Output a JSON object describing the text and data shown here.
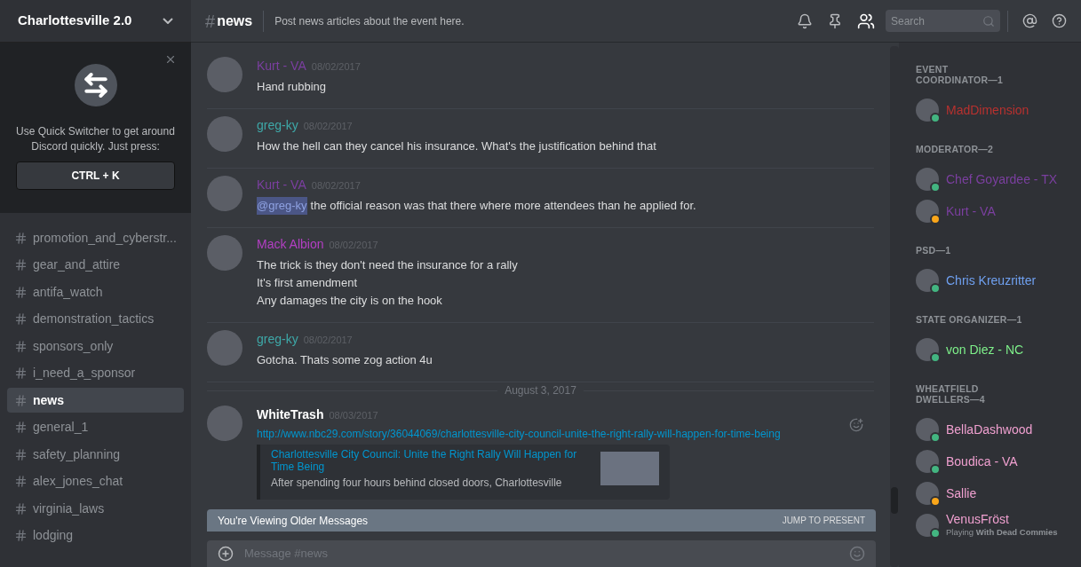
{
  "server": {
    "name": "Charlottesville 2.0"
  },
  "quick_switcher": {
    "text": "Use Quick Switcher to get around Discord quickly. Just press:",
    "shortcut": "CTRL + K"
  },
  "channels": [
    {
      "name": "promotion_and_cyberstr...",
      "selected": false
    },
    {
      "name": "gear_and_attire",
      "selected": false
    },
    {
      "name": "antifa_watch",
      "selected": false
    },
    {
      "name": "demonstration_tactics",
      "selected": false
    },
    {
      "name": "sponsors_only",
      "selected": false
    },
    {
      "name": "i_need_a_sponsor",
      "selected": false
    },
    {
      "name": "news",
      "selected": true
    },
    {
      "name": "general_1",
      "selected": false
    },
    {
      "name": "safety_planning",
      "selected": false
    },
    {
      "name": "alex_jones_chat",
      "selected": false
    },
    {
      "name": "virginia_laws",
      "selected": false
    },
    {
      "name": "lodging",
      "selected": false
    }
  ],
  "header": {
    "hash": "#",
    "channel": "news",
    "topic": "Post news articles about the event here.",
    "search_placeholder": "Search"
  },
  "messages": [
    {
      "author": "Kurt - VA",
      "color": "#7b3fa0",
      "time": "08/02/2017",
      "lines": [
        {
          "text": "Hand rubbing"
        }
      ]
    },
    {
      "author": "greg-ky",
      "color": "#3ea8a8",
      "time": "08/02/2017",
      "lines": [
        {
          "text": "How the hell can they cancel his insurance. What's the justification behind that"
        }
      ]
    },
    {
      "author": "Kurt - VA",
      "color": "#7b3fa0",
      "time": "08/02/2017",
      "lines": [
        {
          "mention": "@greg-ky",
          "text": "the official reason was that there where more attendees than he applied for."
        }
      ]
    },
    {
      "author": "Mack Albion",
      "color": "#b43fc4",
      "time": "08/02/2017",
      "lines": [
        {
          "text": "The trick is they don't need the insurance for a rally"
        },
        {
          "text": "It's first amendment"
        },
        {
          "text": "Any damages the city is on the hook"
        }
      ]
    },
    {
      "author": "greg-ky",
      "color": "#3ea8a8",
      "time": "08/02/2017",
      "lines": [
        {
          "text": "Gotcha. Thats some zog  action 4u"
        }
      ]
    }
  ],
  "date_divider": "August 3, 2017",
  "link_message": {
    "author": "WhiteTrash",
    "color": "#ffffff",
    "time": "08/03/2017",
    "link": "http://www.nbc29.com/story/36044069/charlottesville-city-council-unite-the-right-rally-will-happen-for-time-being",
    "embed_title": "Charlottesville City Council: Unite the Right Rally Will Happen for Time Being",
    "embed_text": "After spending four hours behind closed doors, Charlottesville"
  },
  "older_banner": {
    "text": "You're Viewing Older Messages",
    "action": "JUMP TO PRESENT"
  },
  "composer": {
    "placeholder": "Message #news"
  },
  "members": [
    {
      "role": "EVENT COORDINATOR—1",
      "users": [
        {
          "name": "MadDimension",
          "color": "#b8312f",
          "idle": false
        }
      ]
    },
    {
      "role": "MODERATOR—2",
      "users": [
        {
          "name": "Chef Goyardee - TX",
          "color": "#7b3fa0",
          "idle": false
        },
        {
          "name": "Kurt - VA",
          "color": "#7b3fa0",
          "idle": true
        }
      ]
    },
    {
      "role": "PSD—1",
      "users": [
        {
          "name": "Chris Kreuzritter",
          "color": "#6fa0f0",
          "idle": false
        }
      ]
    },
    {
      "role": "STATE ORGANIZER—1",
      "users": [
        {
          "name": "von Diez - NC",
          "color": "#7ef08a",
          "idle": false
        }
      ]
    },
    {
      "role": "WHEATFIELD DWELLERS—4",
      "users": [
        {
          "name": "BellaDashwood",
          "color": "#f0a0d0",
          "idle": false
        },
        {
          "name": "Boudica - VA",
          "color": "#f0a0d0",
          "idle": false
        },
        {
          "name": "Sallie",
          "color": "#f0a0d0",
          "idle": true
        },
        {
          "name": "VenusFröst",
          "color": "#f0a0d0",
          "idle": false,
          "activity": "Playing",
          "game": "With Dead Commies"
        }
      ]
    }
  ]
}
